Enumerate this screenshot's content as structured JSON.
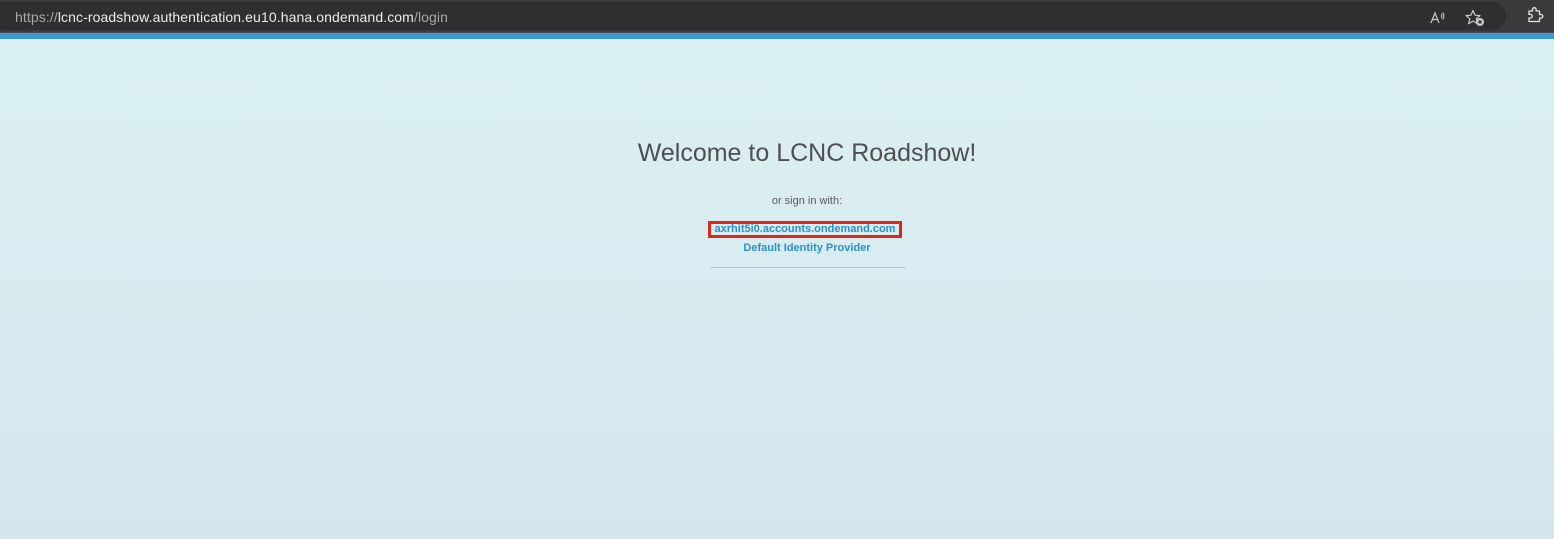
{
  "browser": {
    "url_scheme": "https://",
    "url_host": "lcnc-roadshow.authentication.eu10.hana.ondemand.com",
    "url_path": "/login",
    "icons": [
      "lock-icon",
      "read-aloud-icon",
      "favorites-icon",
      "extensions-icon"
    ]
  },
  "login": {
    "welcome_title": "Welcome to LCNC Roadshow!",
    "sign_in_hint": "or sign in with:",
    "identity_providers": [
      {
        "label": "axrhit5i0.accounts.ondemand.com",
        "highlighted": true
      },
      {
        "label": "Default Identity Provider",
        "highlighted": false
      }
    ]
  },
  "colors": {
    "browser_bar": "#3b3b3e",
    "accent_strip": "#3a9ad3",
    "page_background": "#dbf0f3",
    "link": "#2a8fd0",
    "highlight_border": "#e0261b",
    "title_text": "#4f4f4f"
  }
}
